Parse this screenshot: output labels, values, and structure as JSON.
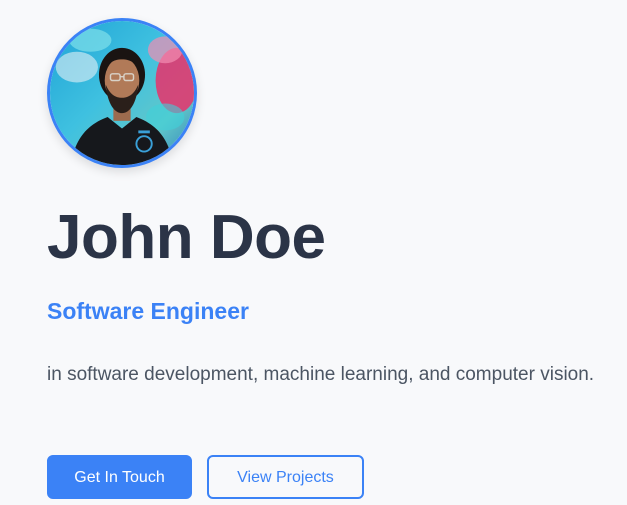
{
  "profile": {
    "avatar_alt": "Profile photo",
    "name": "John Doe",
    "role": "Software Engineer",
    "bio": "in software development, machine learning, and computer vision."
  },
  "actions": {
    "primary_label": "Get In Touch",
    "secondary_label": "View Projects"
  },
  "colors": {
    "accent": "#3b82f6",
    "heading": "#2b3447",
    "body_text": "#4b5563",
    "background": "#f8f9fb"
  }
}
